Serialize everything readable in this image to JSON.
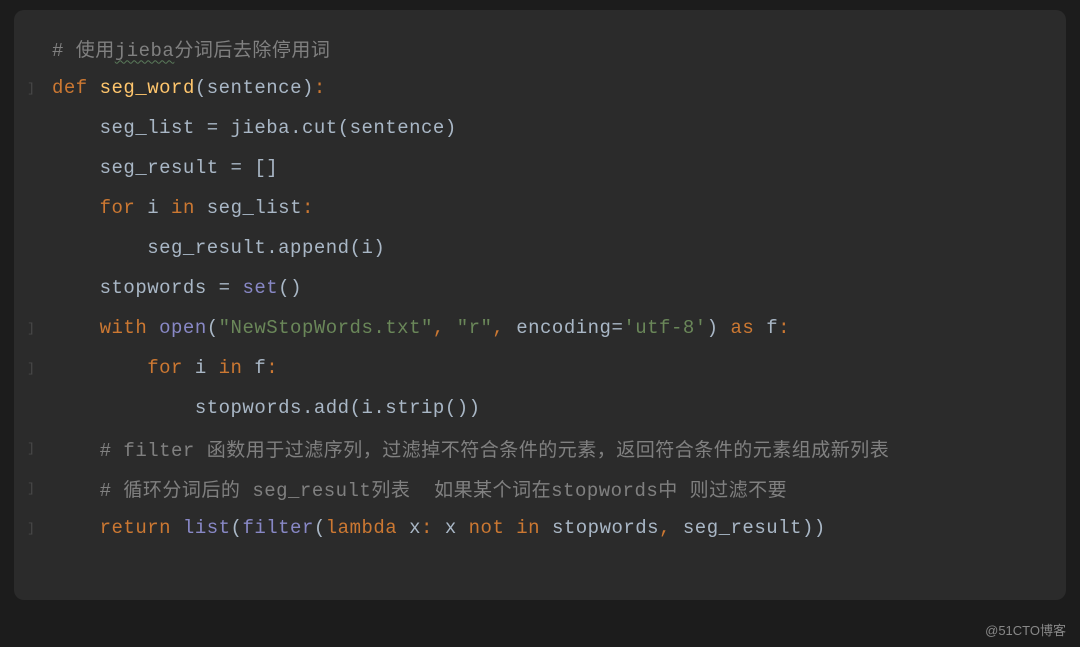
{
  "code": {
    "line1": {
      "comment_prefix": "# 使用",
      "jieba": "jieba",
      "comment_suffix": "分词后去除停用词"
    },
    "line2": {
      "def": "def",
      "fname": "seg_word",
      "paren_open": "(",
      "param": "sentence",
      "paren_close": ")",
      "colon": ":"
    },
    "line3": {
      "var": "seg_list",
      "eq": " = ",
      "obj": "jieba",
      "dot": ".",
      "method": "cut",
      "paren_open": "(",
      "arg": "sentence",
      "paren_close": ")"
    },
    "line4": {
      "var": "seg_result",
      "eq": " = ",
      "brackets": "[]"
    },
    "line5": {
      "for": "for",
      "i": " i ",
      "in": "in",
      "target": " seg_list",
      "colon": ":"
    },
    "line6": {
      "obj": "seg_result",
      "dot": ".",
      "method": "append",
      "paren_open": "(",
      "arg": "i",
      "paren_close": ")"
    },
    "line7": {
      "var": "stopwords",
      "eq": " = ",
      "builtin": "set",
      "parens": "()"
    },
    "line8": {
      "with": "with",
      "open": " open",
      "paren_open": "(",
      "str1": "\"NewStopWords.txt\"",
      "comma1": ", ",
      "str2": "\"r\"",
      "comma2": ", ",
      "kwarg": "encoding",
      "eq": "=",
      "str3": "'utf-8'",
      "paren_close": ")",
      "as": " as ",
      "f": "f",
      "colon": ":"
    },
    "line9": {
      "for": "for",
      "i": " i ",
      "in": "in",
      "target": " f",
      "colon": ":"
    },
    "line10": {
      "obj": "stopwords",
      "dot": ".",
      "method": "add",
      "paren_open": "(",
      "arg": "i",
      "dot2": ".",
      "method2": "strip",
      "parens2": "()",
      "paren_close": ")"
    },
    "line11": {
      "comment": "# filter 函数用于过滤序列，过滤掉不符合条件的元素，返回符合条件的元素组成新列表"
    },
    "line12": {
      "comment": "# 循环分词后的 seg_result列表  如果某个词在stopwords中 则过滤不要"
    },
    "line13": {
      "return": "return",
      "list": " list",
      "p1": "(",
      "filter": "filter",
      "p2": "(",
      "lambda": "lambda",
      "x": " x",
      "colon": ": ",
      "x2": "x ",
      "not": "not in",
      "stopwords": " stopwords",
      "comma": ", ",
      "seg": "seg_result",
      "p3": "))"
    }
  },
  "gutter_mark": "]",
  "watermark": "@51CTO博客"
}
